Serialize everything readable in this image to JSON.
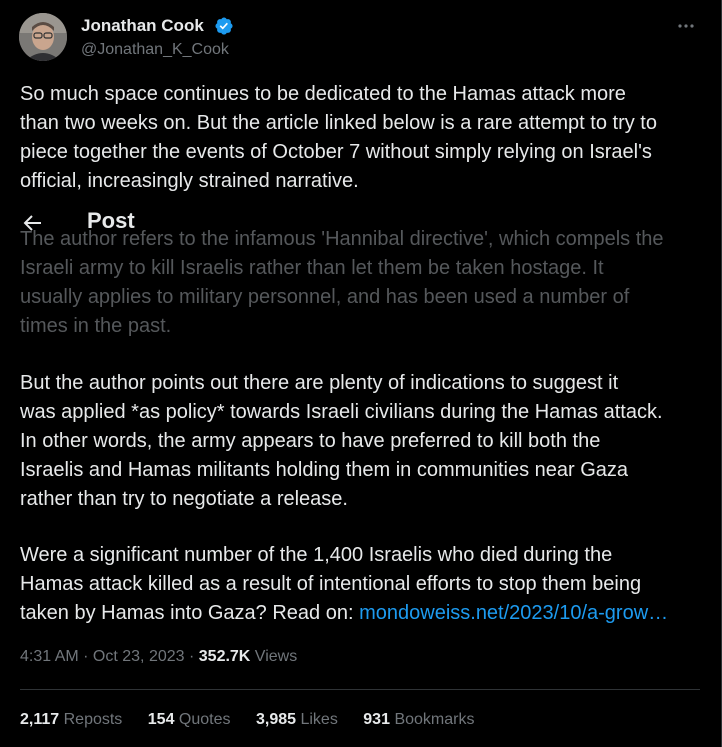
{
  "author": {
    "name": "Jonathan Cook",
    "handle": "@Jonathan_K_Cook",
    "verified_icon": "verified-badge-icon",
    "verified_color": "#1d9bf0"
  },
  "more_icon": "more-horizontal-icon",
  "overlay": {
    "back_icon": "arrow-left-icon",
    "title": "Post"
  },
  "tweet": {
    "p1": "So much space continues to be dedicated to the Hamas attack more\nthan two weeks on. But the article linked below is a rare attempt to try to\npiece together the events of October 7 without simply relying on Israel's\nofficial, increasingly strained narrative.",
    "p2": "The author refers to the infamous 'Hannibal directive', which compels the\nIsraeli army to kill Israelis rather than let them be taken hostage. It\nusually applies to military personnel, and has been used a number of\ntimes in the past.",
    "p3": "But the author points out there are plenty of indications to suggest it\nwas applied *as policy* towards Israeli civilians during the Hamas attack.\nIn other words, the army appears to have preferred to kill both the\nIsraelis and Hamas militants holding them in communities near Gaza\nrather than try to negotiate a release.",
    "p4": "Were a significant number of the 1,400 Israelis who died during the\nHamas attack killed as a result of intentional efforts to stop them being\ntaken by Hamas into Gaza? Read on: ",
    "link": "mondoweiss.net/2023/10/a-grow…"
  },
  "meta": {
    "time": "4:31 AM",
    "separator": " · ",
    "date": "Oct 23, 2023",
    "views_count": "352.7K",
    "views_label": " Views"
  },
  "stats": [
    {
      "count": "2,117",
      "label": "Reposts"
    },
    {
      "count": "154",
      "label": "Quotes"
    },
    {
      "count": "3,985",
      "label": "Likes"
    },
    {
      "count": "931",
      "label": "Bookmarks"
    }
  ],
  "colors": {
    "background": "#000000",
    "text": "#e7e9ea",
    "secondary": "#71767b",
    "link": "#1d9bf0",
    "divider": "#2f3336"
  }
}
